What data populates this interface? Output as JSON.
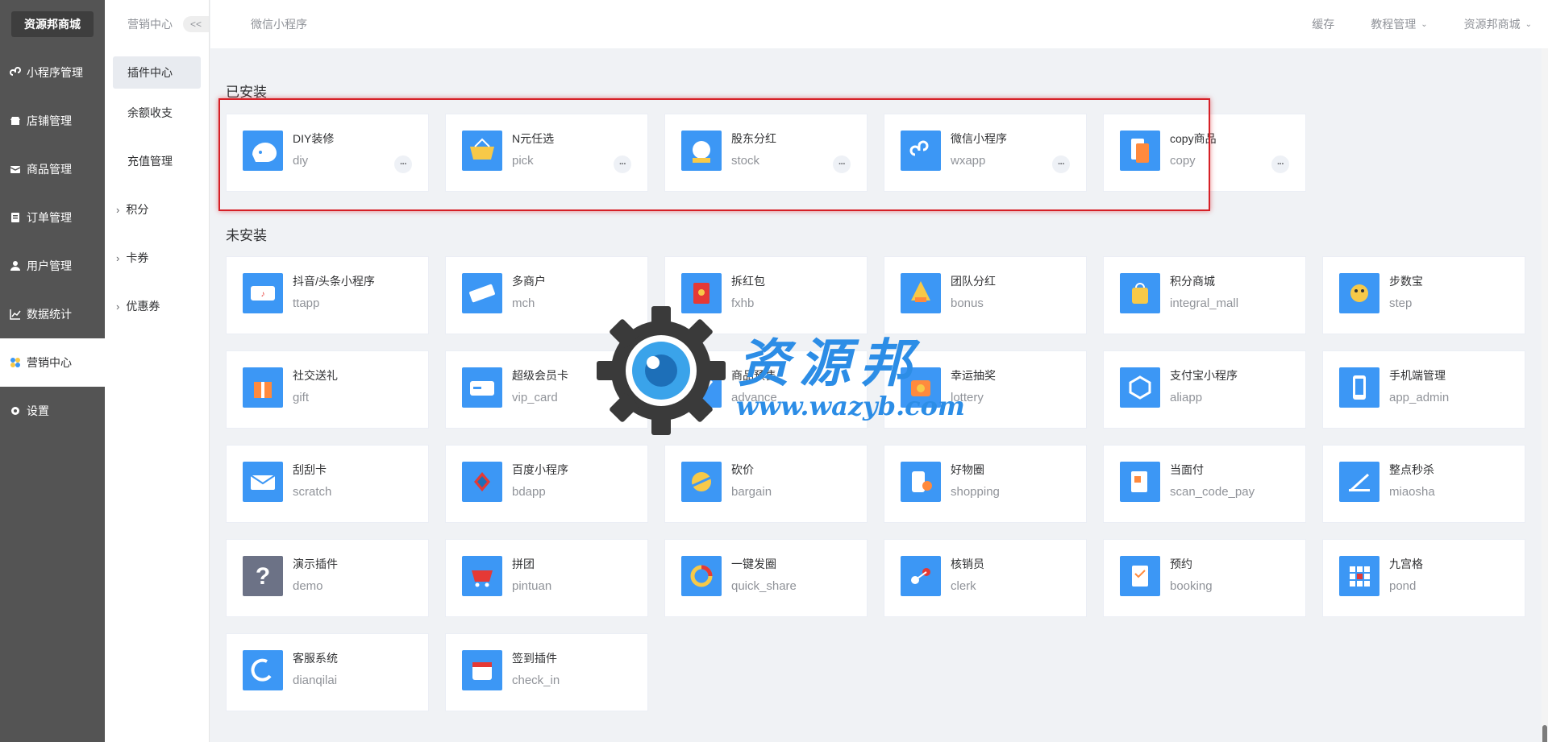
{
  "brand": "资源邦商城",
  "nav": [
    {
      "label": "小程序管理",
      "icon": "link-icon"
    },
    {
      "label": "店铺管理",
      "icon": "shop-icon"
    },
    {
      "label": "商品管理",
      "icon": "box-icon"
    },
    {
      "label": "订单管理",
      "icon": "order-icon"
    },
    {
      "label": "用户管理",
      "icon": "user-icon"
    },
    {
      "label": "数据统计",
      "icon": "chart-icon"
    },
    {
      "label": "营销中心",
      "icon": "marketing-icon",
      "active": true
    },
    {
      "label": "设置",
      "icon": "gear-icon"
    }
  ],
  "subnav": {
    "title": "营销中心",
    "collapse": "<<",
    "items": [
      {
        "label": "插件中心",
        "active": true
      },
      {
        "label": "余额收支"
      },
      {
        "label": "充值管理"
      },
      {
        "label": "积分",
        "group": true
      },
      {
        "label": "卡券",
        "group": true
      },
      {
        "label": "优惠券",
        "group": true
      }
    ]
  },
  "header": {
    "breadcrumb": "微信小程序",
    "cache": "缓存",
    "tutorial": "教程管理",
    "user": "资源邦商城"
  },
  "installed": {
    "title": "已安装",
    "plugins": [
      {
        "name": "DIY装修",
        "code": "diy",
        "icon": "diy-icon"
      },
      {
        "name": "N元任选",
        "code": "pick",
        "icon": "basket-icon"
      },
      {
        "name": "股东分红",
        "code": "stock",
        "icon": "stock-icon"
      },
      {
        "name": "微信小程序",
        "code": "wxapp",
        "icon": "wxapp-icon"
      },
      {
        "name": "copy商品",
        "code": "copy",
        "icon": "copy-icon"
      }
    ],
    "more": "···"
  },
  "uninstalled": {
    "title": "未安装",
    "plugins": [
      {
        "name": "抖音/头条小程序",
        "code": "ttapp",
        "icon": "tiktok-icon"
      },
      {
        "name": "多商户",
        "code": "mch",
        "icon": "merchant-icon"
      },
      {
        "name": "拆红包",
        "code": "fxhb",
        "icon": "red-packet-icon"
      },
      {
        "name": "团队分红",
        "code": "bonus",
        "icon": "bonus-icon"
      },
      {
        "name": "积分商城",
        "code": "integral_mall",
        "icon": "integral-icon"
      },
      {
        "name": "步数宝",
        "code": "step",
        "icon": "step-icon"
      },
      {
        "name": "社交送礼",
        "code": "gift",
        "icon": "gift-icon"
      },
      {
        "name": "超级会员卡",
        "code": "vip_card",
        "icon": "vip-card-icon"
      },
      {
        "name": "商品预售",
        "code": "advance",
        "icon": "advance-icon"
      },
      {
        "name": "幸运抽奖",
        "code": "lottery",
        "icon": "lottery-icon"
      },
      {
        "name": "支付宝小程序",
        "code": "aliapp",
        "icon": "alipay-icon"
      },
      {
        "name": "手机端管理",
        "code": "app_admin",
        "icon": "phone-admin-icon"
      },
      {
        "name": "刮刮卡",
        "code": "scratch",
        "icon": "scratch-icon"
      },
      {
        "name": "百度小程序",
        "code": "bdapp",
        "icon": "baidu-icon"
      },
      {
        "name": "砍价",
        "code": "bargain",
        "icon": "bargain-icon"
      },
      {
        "name": "好物圈",
        "code": "shopping",
        "icon": "shopping-icon"
      },
      {
        "name": "当面付",
        "code": "scan_code_pay",
        "icon": "scan-pay-icon"
      },
      {
        "name": "整点秒杀",
        "code": "miaosha",
        "icon": "miaosha-icon"
      },
      {
        "name": "演示插件",
        "code": "demo",
        "icon": "question-icon",
        "grey": true
      },
      {
        "name": "拼团",
        "code": "pintuan",
        "icon": "pintuan-icon"
      },
      {
        "name": "一键发圈",
        "code": "quick_share",
        "icon": "quick-share-icon"
      },
      {
        "name": "核销员",
        "code": "clerk",
        "icon": "clerk-icon"
      },
      {
        "name": "预约",
        "code": "booking",
        "icon": "booking-icon"
      },
      {
        "name": "九宫格",
        "code": "pond",
        "icon": "grid-icon"
      },
      {
        "name": "客服系统",
        "code": "dianqilai",
        "icon": "service-icon"
      },
      {
        "name": "签到插件",
        "code": "check_in",
        "icon": "checkin-icon"
      }
    ]
  },
  "watermark": {
    "text": "资源邦",
    "url": "www.wazyb.com"
  },
  "colors": {
    "sidebar": "#545454",
    "accent": "#3c97f5",
    "highlight": "#d62027"
  }
}
